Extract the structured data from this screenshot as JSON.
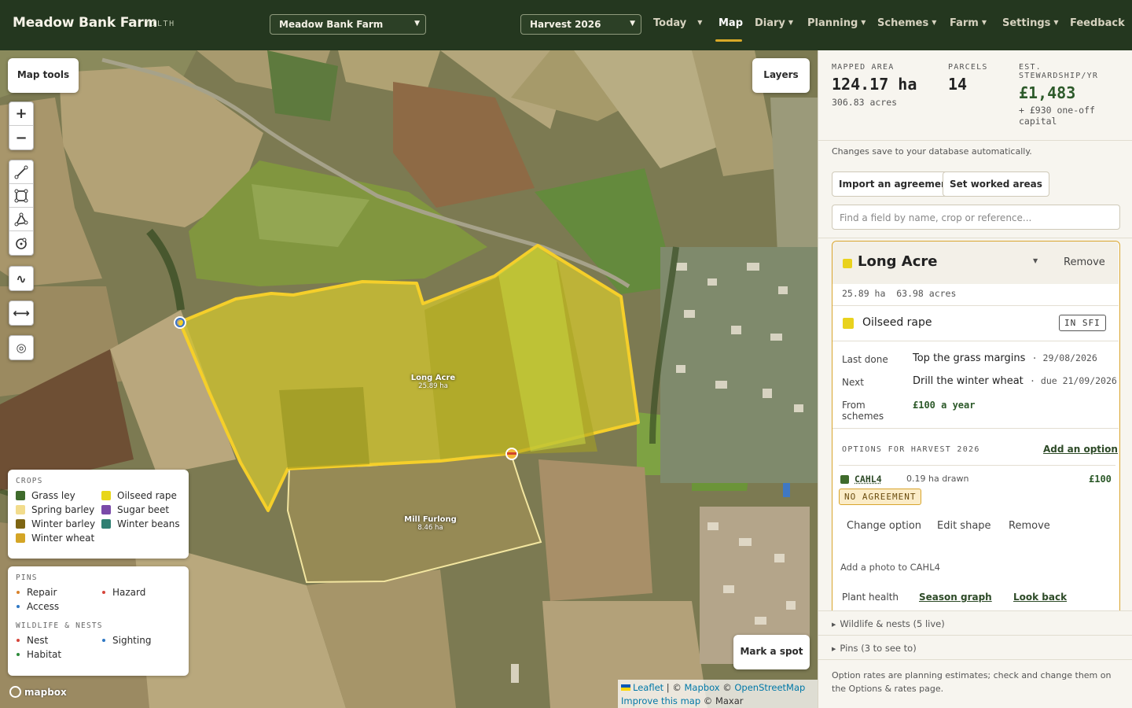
{
  "header": {
    "brand": "Meadow Bank Farm",
    "brand_tag": "TILTH",
    "farm_select": "Meadow Bank Farm",
    "harvest_select": "Harvest 2026",
    "nav": {
      "today": "Today",
      "map": "Map",
      "diary": "Diary",
      "planning": "Planning",
      "schemes": "Schemes",
      "farm": "Farm",
      "settings": "Settings",
      "feedback": "Feedback"
    }
  },
  "map": {
    "map_tools": "Map tools",
    "layers": "Layers",
    "mark_spot": "Mark a spot",
    "zoom_in": "+",
    "zoom_out": "−",
    "fields": [
      {
        "name": "Long Acre",
        "area": "25.89 ha"
      },
      {
        "name": "Mill Furlong",
        "area": "8.46 ha"
      }
    ],
    "legend": {
      "crops_title": "CROPS",
      "crops": [
        {
          "label": "Grass ley",
          "color": "#3f6b2c"
        },
        {
          "label": "Oilseed rape",
          "color": "#e8d619"
        },
        {
          "label": "Spring barley",
          "color": "#f2dc8c"
        },
        {
          "label": "Sugar beet",
          "color": "#7a4aa8"
        },
        {
          "label": "Winter barley",
          "color": "#7e6512"
        },
        {
          "label": "Winter beans",
          "color": "#2f7f72"
        },
        {
          "label": "Winter wheat",
          "color": "#d4a526"
        }
      ],
      "pins_title": "PINS",
      "pins": [
        {
          "label": "Repair",
          "color": "#d9822b"
        },
        {
          "label": "Hazard",
          "color": "#d6453a"
        },
        {
          "label": "Access",
          "color": "#2f78c4"
        }
      ],
      "wildlife_title": "WILDLIFE & NESTS",
      "wildlife": [
        {
          "label": "Nest",
          "color": "#d6453a"
        },
        {
          "label": "Sighting",
          "color": "#2f78c4"
        },
        {
          "label": "Habitat",
          "color": "#2e8a3a"
        }
      ]
    },
    "mapbox": "mapbox",
    "attribution": {
      "leaflet": "Leaflet",
      "sep1": " | © ",
      "mapbox": "Mapbox",
      "sep2": " © ",
      "osm": "OpenStreetMap",
      "improve": "Improve this map",
      "maxar": " © Maxar"
    }
  },
  "panel": {
    "stats": {
      "mapped_label": "MAPPED AREA",
      "mapped_value": "124.17 ha",
      "mapped_sub": "306.83 acres",
      "parcels_label": "PARCELS",
      "parcels_value": "14",
      "stewardship_label_1": "EST.",
      "stewardship_label_2": "STEWARDSHIP/YR",
      "stewardship_value": "£1,483",
      "stewardship_sub_1": "+ £930 one-off",
      "stewardship_sub_2": "capital"
    },
    "autosave_note": "Changes save to your database automatically.",
    "import_button": "Import an agreement",
    "worked_button": "Set worked areas",
    "search_placeholder": "Find a field by name, crop or reference...",
    "field": {
      "name": "Long Acre",
      "remove": "Remove",
      "area": "25.89 ha  63.98 acres",
      "crop": "Oilseed rape",
      "crop_badge": "IN SFI",
      "last_done_label": "Last done",
      "last_done_value": "Top the grass margins",
      "last_done_date": "· 29/08/2026",
      "next_label": "Next",
      "next_value": "Drill the winter wheat",
      "next_date": "· due 21/09/2026",
      "schemes_label_1": "From",
      "schemes_label_2": "schemes",
      "schemes_value": "£100 a year",
      "options_title": "OPTIONS FOR HARVEST 2026",
      "add_option": "Add an option",
      "option_code": "CAHL4",
      "option_area": "0.19 ha drawn",
      "option_value": "£100",
      "option_badge": "NO AGREEMENT",
      "change_option": "Change option",
      "edit_shape": "Edit shape",
      "remove_option": "Remove",
      "add_photo": "Add a photo to CAHL4",
      "plant_health": "Plant health",
      "season_graph": "Season graph",
      "look_back": "Look back"
    },
    "wildlife_section": "Wildlife & nests (5 live)",
    "pins_section": "Pins (3 to see to)",
    "footer": "Option rates are planning estimates; check and change them on the Options & rates page."
  }
}
